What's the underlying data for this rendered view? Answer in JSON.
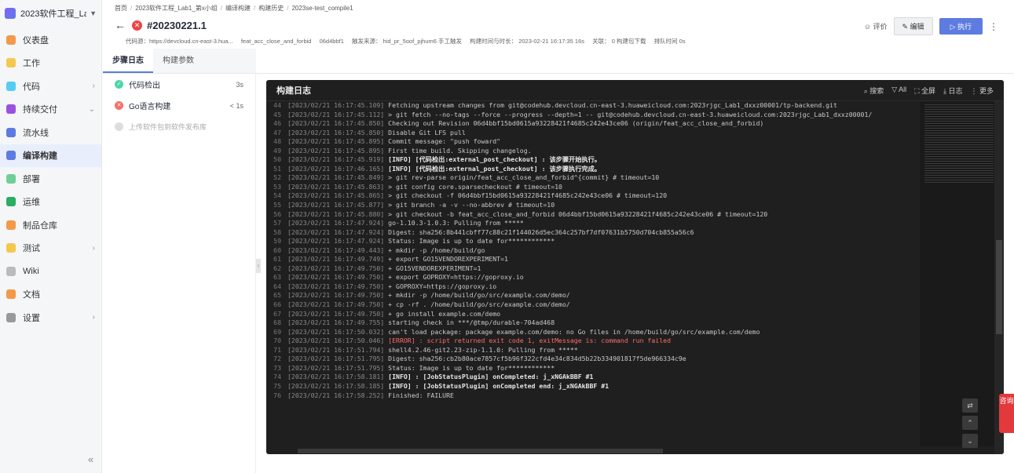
{
  "project": {
    "name": "2023软件工程_Lab...",
    "caret": "▼"
  },
  "sidebar": {
    "items": [
      {
        "label": "仪表盘",
        "color": "#f2994a",
        "arrow": ""
      },
      {
        "label": "工作",
        "color": "#f2c94c",
        "arrow": ""
      },
      {
        "label": "代码",
        "color": "#56ccf2",
        "arrow": "›"
      },
      {
        "label": "持续交付",
        "color": "#9b51e0",
        "arrow": "⌄"
      },
      {
        "label": "流水线",
        "color": "#5e7ce0",
        "arrow": ""
      },
      {
        "label": "编译构建",
        "color": "#5e7ce0",
        "arrow": ""
      },
      {
        "label": "部署",
        "color": "#6fcf97",
        "arrow": ""
      },
      {
        "label": "运维",
        "color": "#27ae60",
        "arrow": ""
      },
      {
        "label": "制品仓库",
        "color": "#f2994a",
        "arrow": ""
      },
      {
        "label": "测试",
        "color": "#f2c94c",
        "arrow": "›"
      },
      {
        "label": "Wiki",
        "color": "#bbbbbb",
        "arrow": ""
      },
      {
        "label": "文档",
        "color": "#f2994a",
        "arrow": ""
      },
      {
        "label": "设置",
        "color": "#999999",
        "arrow": "›"
      }
    ],
    "collapse": "«"
  },
  "breadcrumb": [
    "首页",
    "2023软件工程_Lab1_第x小组",
    "编译构建",
    "构建历史",
    "2023se-test_compile1"
  ],
  "build": {
    "back": "←",
    "status_icon": "✕",
    "number": "#20230221.1"
  },
  "meta": {
    "repo": "代码源：https://devcloud.cn-east-3.hua...",
    "branch": "feat_acc_close_and_forbid",
    "commit": "06d4bbf1",
    "trigger": "触发来源： hid_pr_5oof_pjhum6  手工触发",
    "time": "构建时间与时长： 2023-02-21 16:17:35  16s",
    "related": "关联： 0 构建包下载",
    "queue": "排队时间 0s"
  },
  "actions": {
    "rate": "☺ 评价",
    "edit": "✎ 编辑",
    "run": "▷ 执行",
    "more": "⋮"
  },
  "tabs": [
    "步骤日志",
    "构建参数"
  ],
  "steps": [
    {
      "name": "代码检出",
      "duration": "3s",
      "status": "success"
    },
    {
      "name": "Go语言构建",
      "duration": "< 1s",
      "status": "fail"
    },
    {
      "name": "上传软件包到软件发布库",
      "duration": "",
      "status": "pending"
    }
  ],
  "log": {
    "title": "构建日志",
    "tools": [
      "⌕ 搜索",
      "▽ All",
      "⛶ 全屏",
      "⤓ 日志",
      "⋮ 更多"
    ],
    "lines": [
      {
        "n": "44",
        "ts": "[2023/02/21 16:17:45.109]",
        "text": " Fetching upstream changes from git@codehub.devcloud.cn-east-3.huaweicloud.com:2023rjgc_Lab1_dxxz00001/tp-backend.git",
        "kind": "normal"
      },
      {
        "n": "45",
        "ts": "[2023/02/21 16:17:45.112]",
        "text": "  > git fetch --no-tags --force --progress --depth=1 -- git@codehub.devcloud.cn-east-3.huaweicloud.com:2023rjgc_Lab1_dxxz00001/",
        "kind": "normal"
      },
      {
        "n": "46",
        "ts": "[2023/02/21 16:17:45.850]",
        "text": " Checking out Revision 06d4bbf15bd0615a93228421f4685c242e43ce06 (origin/feat_acc_close_and_forbid)",
        "kind": "normal"
      },
      {
        "n": "47",
        "ts": "[2023/02/21 16:17:45.850]",
        "text": " Disable Git LFS pull",
        "kind": "normal"
      },
      {
        "n": "48",
        "ts": "[2023/02/21 16:17:45.895]",
        "text": " Commit message: \"push foward\"",
        "kind": "normal"
      },
      {
        "n": "49",
        "ts": "[2023/02/21 16:17:45.895]",
        "text": " First time build. Skipping changelog.",
        "kind": "normal"
      },
      {
        "n": "50",
        "ts": "[2023/02/21 16:17:45.919]",
        "text": " [INFO] [代码检出:external_post_checkout] : 该步骤开始执行。",
        "kind": "info"
      },
      {
        "n": "51",
        "ts": "[2023/02/21 16:17:46.165]",
        "text": " [INFO] [代码检出:external_post_checkout] : 该步骤执行完成。",
        "kind": "info"
      },
      {
        "n": "52",
        "ts": "[2023/02/21 16:17:45.849]",
        "text": "  > git rev-parse origin/feat_acc_close_and_forbid^{commit} # timeout=10",
        "kind": "normal"
      },
      {
        "n": "53",
        "ts": "[2023/02/21 16:17:45.863]",
        "text": "  > git config core.sparsecheckout # timeout=10",
        "kind": "normal"
      },
      {
        "n": "54",
        "ts": "[2023/02/21 16:17:45.865]",
        "text": "  > git checkout -f 06d4bbf15bd0615a93228421f4685c242e43ce06 # timeout=120",
        "kind": "normal"
      },
      {
        "n": "55",
        "ts": "[2023/02/21 16:17:45.877]",
        "text": "  > git branch -a -v --no-abbrev # timeout=10",
        "kind": "normal"
      },
      {
        "n": "56",
        "ts": "[2023/02/21 16:17:45.880]",
        "text": "  > git checkout -b feat_acc_close_and_forbid 06d4bbf15bd0615a93228421f4685c242e43ce06 # timeout=120",
        "kind": "normal"
      },
      {
        "n": "57",
        "ts": "[2023/02/21 16:17:47.924]",
        "text": " go-1.10.3-1.0.3: Pulling from *****",
        "kind": "normal"
      },
      {
        "n": "58",
        "ts": "[2023/02/21 16:17:47.924]",
        "text": " Digest: sha256:8b441cbff77c88c21f144026d5ec364c257bf7df07631b5750d704cb855a56c6",
        "kind": "normal"
      },
      {
        "n": "59",
        "ts": "[2023/02/21 16:17:47.924]",
        "text": " Status: Image is up to date for************",
        "kind": "normal"
      },
      {
        "n": "60",
        "ts": "[2023/02/21 16:17:49.443]",
        "text": " + mkdir -p /home/build/go",
        "kind": "normal"
      },
      {
        "n": "61",
        "ts": "[2023/02/21 16:17:49.749]",
        "text": " + export GO15VENDOREXPERIMENT=1",
        "kind": "normal"
      },
      {
        "n": "62",
        "ts": "[2023/02/21 16:17:49.750]",
        "text": " + GO15VENDOREXPERIMENT=1",
        "kind": "normal"
      },
      {
        "n": "63",
        "ts": "[2023/02/21 16:17:49.750]",
        "text": " + export GOPROXY=https://goproxy.io",
        "kind": "normal"
      },
      {
        "n": "64",
        "ts": "[2023/02/21 16:17:49.750]",
        "text": " + GOPROXY=https://goproxy.io",
        "kind": "normal"
      },
      {
        "n": "65",
        "ts": "[2023/02/21 16:17:49.750]",
        "text": " + mkdir -p /home/build/go/src/example.com/demo/",
        "kind": "normal"
      },
      {
        "n": "66",
        "ts": "[2023/02/21 16:17:49.750]",
        "text": " + cp -rf . /home/build/go/src/example.com/demo/",
        "kind": "normal"
      },
      {
        "n": "67",
        "ts": "[2023/02/21 16:17:49.750]",
        "text": " + go install example.com/demo",
        "kind": "normal"
      },
      {
        "n": "68",
        "ts": "[2023/02/21 16:17:49.755]",
        "text": " starting check in ***/@tmp/durable-704ad468",
        "kind": "normal"
      },
      {
        "n": "69",
        "ts": "[2023/02/21 16:17:50.032]",
        "text": " can't load package: package example.com/demo: no Go files in /home/build/go/src/example.com/demo",
        "kind": "normal"
      },
      {
        "n": "70",
        "ts": "[2023/02/21 16:17:50.046]",
        "text": " [ERROR]  : script returned exit code 1, exitMessage is: command run failed",
        "kind": "error"
      },
      {
        "n": "71",
        "ts": "[2023/02/21 16:17:51.794]",
        "text": " shell4.2.46-git2.23-zip-1.1.0: Pulling from *****",
        "kind": "normal"
      },
      {
        "n": "72",
        "ts": "[2023/02/21 16:17:51.795]",
        "text": " Digest: sha256:cb2b80ace7857cf5b96f322cfd4e34c834d5b22b334901817f5de966334c9e",
        "kind": "normal"
      },
      {
        "n": "73",
        "ts": "[2023/02/21 16:17:51.795]",
        "text": " Status: Image is up to date for************",
        "kind": "normal"
      },
      {
        "n": "74",
        "ts": "[2023/02/21 16:17:58.181]",
        "text": " [INFO]  : [JobStatusPlugin] onCompleted: j_xNGAkBBF #1",
        "kind": "info"
      },
      {
        "n": "75",
        "ts": "[2023/02/21 16:17:58.185]",
        "text": " [INFO]  : [JobStatusPlugin] onCompleted end: j_xNGAkBBF #1",
        "kind": "info"
      },
      {
        "n": "76",
        "ts": "[2023/02/21 16:17:58.252]",
        "text": " Finished: FAILURE",
        "kind": "normal"
      }
    ],
    "fab": [
      "⇄",
      "⌃",
      "⌄"
    ]
  },
  "consult": "咨询"
}
